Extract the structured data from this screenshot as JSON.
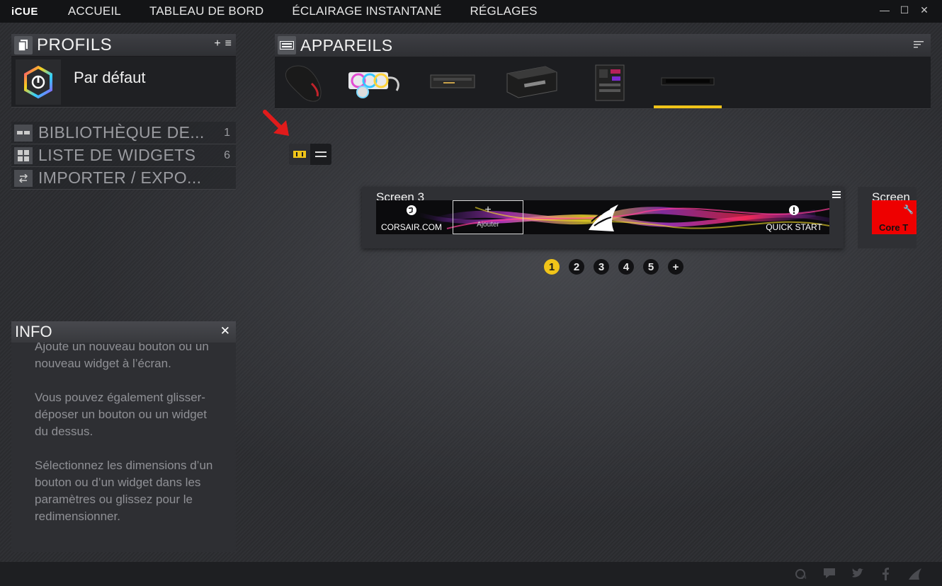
{
  "app": {
    "logo": "iCUE"
  },
  "nav": {
    "items": [
      "ACCUEIL",
      "TABLEAU DE BORD",
      "ÉCLAIRAGE INSTANTANÉ",
      "RÉGLAGES"
    ]
  },
  "window_controls": {
    "minimize": "—",
    "maximize": "☐",
    "close": "✕"
  },
  "profiles": {
    "title": "PROFILS",
    "add": "+",
    "menu": "≡",
    "current": "Par défaut"
  },
  "menu": [
    {
      "label": "BIBLIOTHÈQUE DE...",
      "count": "1"
    },
    {
      "label": "LISTE DE WIDGETS",
      "count": "6"
    },
    {
      "label": "IMPORTER / EXPO...",
      "count": ""
    }
  ],
  "info": {
    "title": "INFO",
    "close": "✕",
    "paragraphs": [
      "Ajoute un nouveau bouton ou un nouveau widget à l’écran.",
      "Vous pouvez également glisser-déposer un bouton ou un widget du dessus.",
      "Sélectionnez les dimensions d’un bouton ou d’un widget dans les paramètres ou glissez pour le redimensionner."
    ]
  },
  "devices": {
    "title": "APPAREILS",
    "items": [
      "mouse",
      "aio-cooler",
      "memory",
      "psu",
      "motherboard",
      "stream-deck"
    ]
  },
  "screen": {
    "label": "Screen 3",
    "buttons": {
      "left": "CORSAIR.COM",
      "add": "Ajouter",
      "right": "QUICK START"
    },
    "next_label": "Screen",
    "next_button": "Core T"
  },
  "pager": {
    "pages": [
      "1",
      "2",
      "3",
      "4",
      "5",
      "+"
    ],
    "active": "1"
  },
  "colors": {
    "accent": "#f0c419",
    "arrow": "#e11b1b"
  }
}
